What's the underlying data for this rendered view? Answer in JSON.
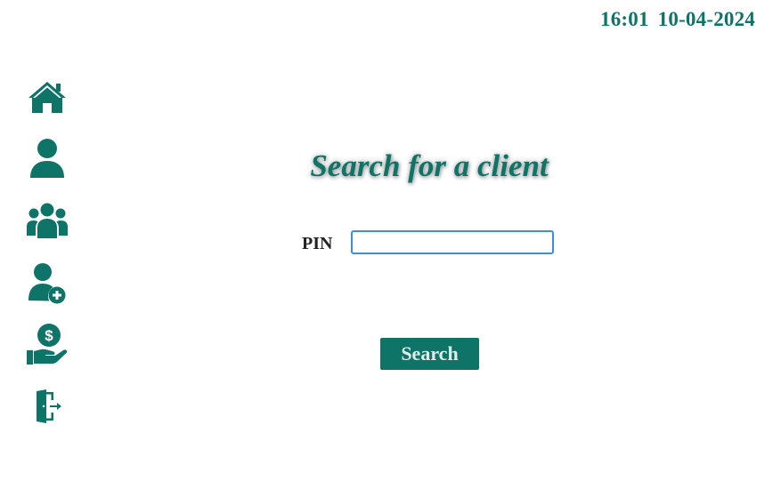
{
  "header": {
    "time": "16:01",
    "date": "10-04-2024"
  },
  "sidebar": {
    "items": [
      {
        "icon": "home-icon"
      },
      {
        "icon": "user-icon"
      },
      {
        "icon": "users-group-icon"
      },
      {
        "icon": "add-user-icon"
      },
      {
        "icon": "money-hand-icon"
      },
      {
        "icon": "logout-door-icon"
      }
    ]
  },
  "main": {
    "title": "Search for a client",
    "pin_label": "PIN",
    "pin_value": "",
    "search_label": "Search"
  },
  "colors": {
    "accent": "#0e7468",
    "input_border": "#3d8ee0"
  }
}
